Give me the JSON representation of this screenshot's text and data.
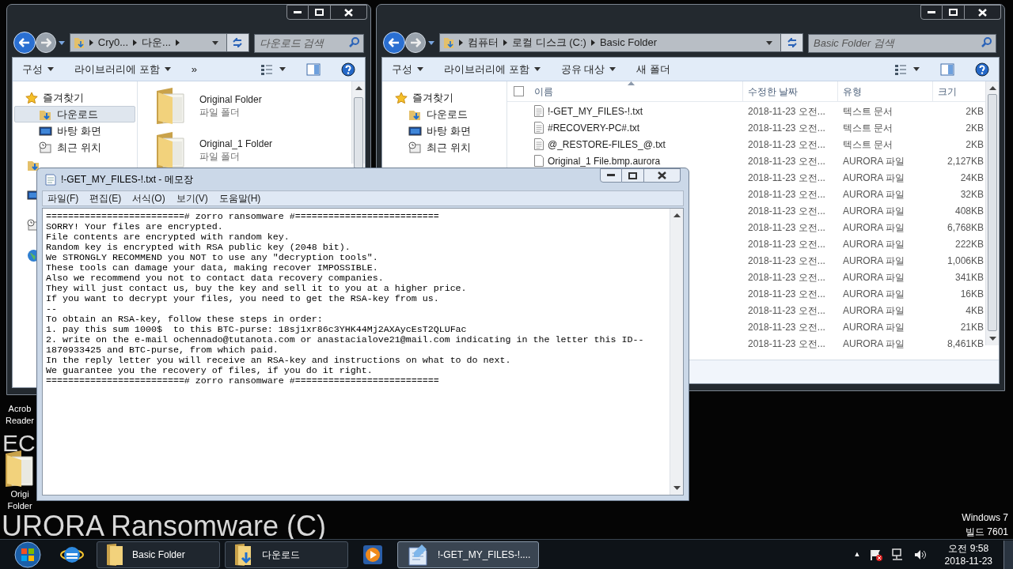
{
  "desktop": {
    "wallpaper_texts": [
      {
        "kind": "short",
        "text": "EC"
      },
      {
        "kind": "long",
        "text": "URORA Ransomware (C)"
      }
    ],
    "icons": [
      {
        "kind": "app",
        "label_lines": [
          "Acrob",
          "Reader"
        ]
      },
      {
        "kind": "folder",
        "label_lines": [
          "Origi",
          "Folder"
        ]
      }
    ],
    "os_notice": [
      "Windows 7",
      "빌드 7601"
    ]
  },
  "explorer_left": {
    "breadcrumb": {
      "segments": [
        "Cry0...",
        "다운..."
      ],
      "trailing_separator": true
    },
    "search": {
      "placeholder": "다운로드 검색"
    },
    "toolbar": [
      {
        "label": "구성",
        "dropdown": true
      },
      {
        "label": "라이브러리에 포함",
        "dropdown": true
      },
      {
        "label": "»",
        "dropdown": false
      }
    ],
    "nav": [
      {
        "label": "즐겨찾기",
        "children": [
          {
            "label": "다운로드",
            "kind": "downloads",
            "selected": true
          },
          {
            "label": "바탕 화면",
            "kind": "desktop",
            "selected": false
          },
          {
            "label": "최근 위치",
            "kind": "recent",
            "selected": false
          }
        ]
      }
    ],
    "items": [
      {
        "name": "Original Folder",
        "type": "파일 폴더"
      },
      {
        "name": "Original_1 Folder",
        "type": "파일 폴더"
      }
    ]
  },
  "explorer_right": {
    "breadcrumb": {
      "segments": [
        "컴퓨터",
        "로컬 디스크 (C:)",
        "Basic Folder"
      ],
      "trailing_separator": false
    },
    "search": {
      "placeholder": "Basic Folder 검색"
    },
    "toolbar": [
      {
        "label": "구성",
        "dropdown": true
      },
      {
        "label": "라이브러리에 포함",
        "dropdown": true
      },
      {
        "label": "공유 대상",
        "dropdown": true
      },
      {
        "label": "새 폴더",
        "dropdown": false
      }
    ],
    "nav": [
      {
        "label": "즐겨찾기",
        "children": [
          {
            "label": "다운로드",
            "kind": "downloads",
            "selected": false
          },
          {
            "label": "바탕 화면",
            "kind": "desktop",
            "selected": false
          },
          {
            "label": "최근 위치",
            "kind": "recent",
            "selected": false
          }
        ]
      }
    ],
    "select_all_checked": false,
    "columns": [
      {
        "label": "이름",
        "sorted": true
      },
      {
        "label": "수정한 날짜",
        "sorted": false
      },
      {
        "label": "유형",
        "sorted": false
      },
      {
        "label": "크기",
        "sorted": false
      }
    ],
    "rows": [
      {
        "name": "!-GET_MY_FILES-!.txt",
        "kind": "text",
        "date": "2018-11-23 오전...",
        "type": "텍스트 문서",
        "size": "2KB"
      },
      {
        "name": "#RECOVERY-PC#.txt",
        "kind": "text",
        "date": "2018-11-23 오전...",
        "type": "텍스트 문서",
        "size": "2KB"
      },
      {
        "name": "@_RESTORE-FILES_@.txt",
        "kind": "text",
        "date": "2018-11-23 오전...",
        "type": "텍스트 문서",
        "size": "2KB"
      },
      {
        "name": "Original_1 File.bmp.aurora",
        "kind": "file",
        "date": "2018-11-23 오전...",
        "type": "AURORA 파일",
        "size": "2,127KB"
      },
      {
        "date": "2018-11-23 오전...",
        "type": "AURORA 파일",
        "size": "24KB"
      },
      {
        "date": "2018-11-23 오전...",
        "type": "AURORA 파일",
        "size": "32KB"
      },
      {
        "date": "2018-11-23 오전...",
        "type": "AURORA 파일",
        "size": "408KB"
      },
      {
        "date": "2018-11-23 오전...",
        "type": "AURORA 파일",
        "size": "6,768KB"
      },
      {
        "date": "2018-11-23 오전...",
        "type": "AURORA 파일",
        "size": "222KB"
      },
      {
        "date": "2018-11-23 오전...",
        "type": "AURORA 파일",
        "size": "1,006KB"
      },
      {
        "date": "2018-11-23 오전...",
        "type": "AURORA 파일",
        "size": "341KB"
      },
      {
        "date": "2018-11-23 오전...",
        "type": "AURORA 파일",
        "size": "16KB"
      },
      {
        "date": "2018-11-23 오전...",
        "type": "AURORA 파일",
        "size": "4KB"
      },
      {
        "date": "2018-11-23 오전...",
        "type": "AURORA 파일",
        "size": "21KB"
      },
      {
        "date": "2018-11-23 오전...",
        "type": "AURORA 파일",
        "size": "8,461KB"
      }
    ]
  },
  "notepad": {
    "title": "!-GET_MY_FILES-!.txt - 메모장",
    "menu": [
      "파일(F)",
      "편집(E)",
      "서식(O)",
      "보기(V)",
      "도움말(H)"
    ],
    "lines": [
      "=========================# zorro ransomware #==========================",
      "SORRY! Your files are encrypted.",
      "File contents are encrypted with random key.",
      "Random key is encrypted with RSA public key (2048 bit).",
      "We STRONGLY RECOMMEND you NOT to use any \"decryption tools\".",
      "These tools can damage your data, making recover IMPOSSIBLE.",
      "Also we recommend you not to contact data recovery companies.",
      "They will just contact us, buy the key and sell it to you at a higher price.",
      "If you want to decrypt your files, you need to get the RSA-key from us.",
      "--",
      "To obtain an RSA-key, follow these steps in order:",
      "1. pay this sum 1000$  to this BTC-purse: 18sj1xr86c3YHK44Mj2AXAycEsT2QLUFac",
      "2. write on the e-mail ochennado@tutanota.com or anastacialove21@mail.com indicating in the letter this ID--",
      "1870933425 and BTC-purse, from which paid.",
      "In the reply letter you will receive an RSA-key and instructions on what to do next.",
      "We guarantee you the recovery of files, if you do it right.",
      "=========================# zorro ransomware #=========================="
    ]
  },
  "taskbar": {
    "buttons": [
      {
        "kind": "start",
        "selected": false
      },
      {
        "kind": "browser",
        "selected": false
      },
      {
        "kind": "folder",
        "label": "Basic Folder",
        "selected": false
      },
      {
        "kind": "downloads",
        "label": "다운로드",
        "selected": false
      },
      {
        "kind": "media",
        "selected": false
      },
      {
        "kind": "notepad",
        "label": "!-GET_MY_FILES-!....",
        "selected": true
      }
    ],
    "tray": {
      "expand": "▲",
      "time": "오전 9:58",
      "date": "2018-11-23"
    }
  }
}
